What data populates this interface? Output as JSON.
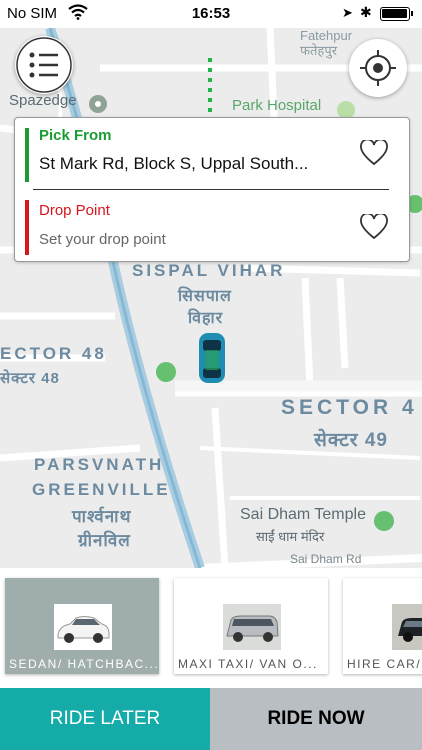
{
  "status_bar": {
    "carrier": "No SIM",
    "time": "16:53"
  },
  "map": {
    "labels": {
      "spazedge": "Spazedge",
      "park_hospital": "Park Hospital",
      "sispal_vihar": "SISPAL VIHAR",
      "sispal_hindi_1": "सिसपाल",
      "sispal_hindi_2": "विहार",
      "sector48": "ECTOR 48",
      "sector48_hindi": "सेक्टर 48",
      "sector49": "SECTOR 4",
      "sector49_hindi": "सेक्टर 49",
      "parsvnath": "PARSVNATH",
      "greenville": "GREENVILLE",
      "parsvnath_hindi": "पार्श्वनाथ",
      "greenville_hindi": "ग्रीनविल",
      "sai_dham": "Sai Dham Temple",
      "sai_dham_hindi": "साईं धाम मंदिर",
      "sai_dham_rd": "Sai Dham Rd",
      "top_right_1": "Fatehpur",
      "top_right_2": "फतेहपुर"
    }
  },
  "address_card": {
    "pick_title": "Pick From",
    "pick_address": "St Mark Rd, Block S, Uppal South...",
    "drop_title": "Drop Point",
    "drop_placeholder": "Set your drop point"
  },
  "car_types": [
    {
      "label": "SEDAN/ HATCHBAC...",
      "selected": true
    },
    {
      "label": "MAXI TAXI/ VAN O...",
      "selected": false
    },
    {
      "label": "HIRE CAR/...",
      "selected": false
    }
  ],
  "buttons": {
    "ride_later": "RIDE LATER",
    "ride_now": "RIDE NOW"
  },
  "colors": {
    "accent": "#14aba8",
    "pick_green": "#1b9b32",
    "drop_red": "#d8141c"
  }
}
